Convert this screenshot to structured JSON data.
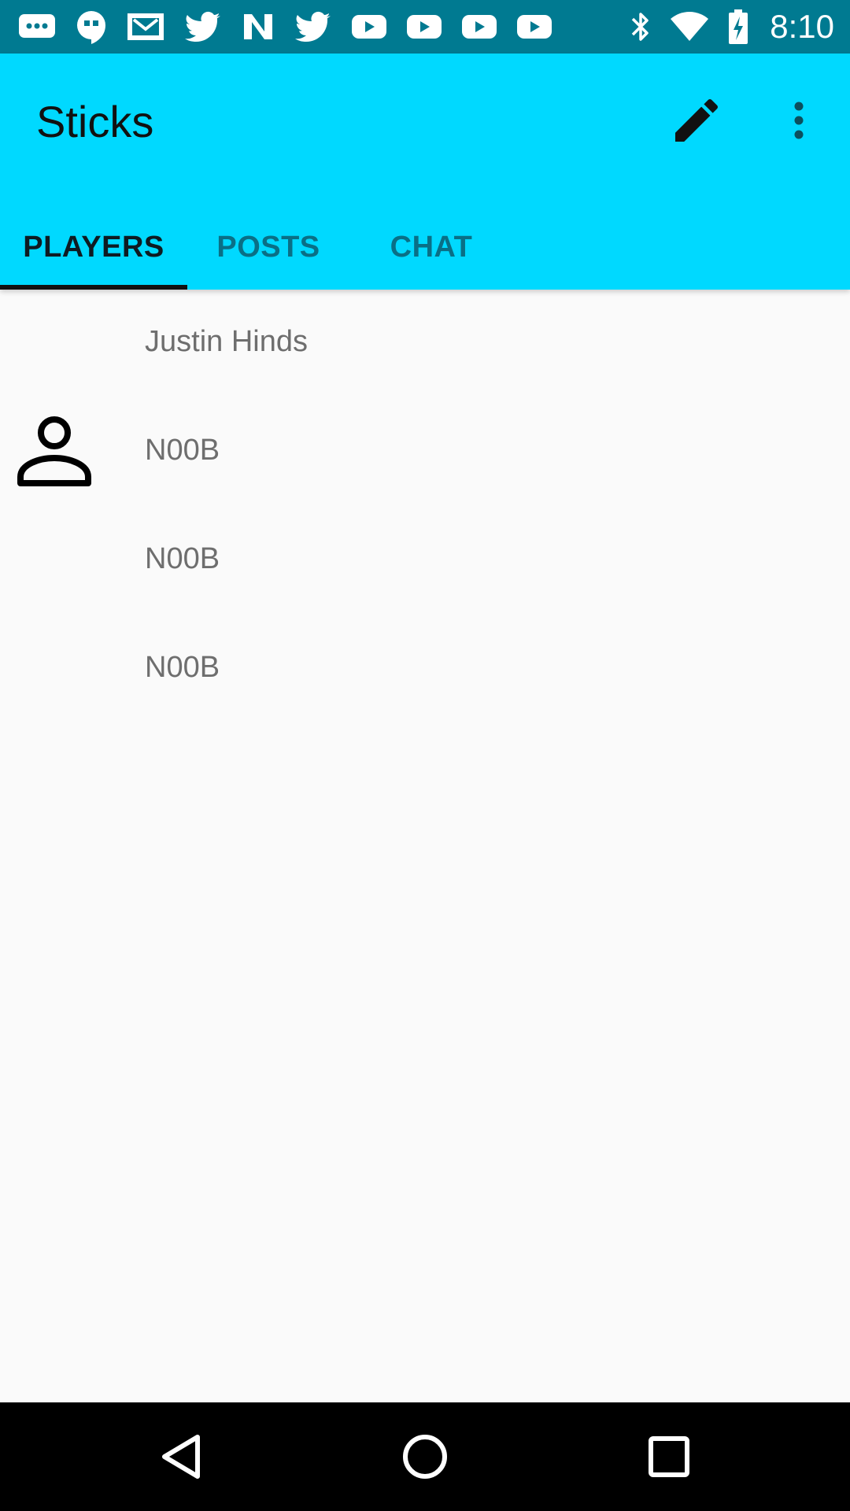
{
  "status_bar": {
    "time": "8:10",
    "notification_icons": [
      "message-icon",
      "hangouts-icon",
      "gmail-icon",
      "twitter-icon",
      "news-icon",
      "twitter-icon",
      "youtube-icon",
      "youtube-icon",
      "youtube-icon",
      "youtube-icon"
    ],
    "system_icons": [
      "bluetooth-icon",
      "wifi-icon",
      "battery-charging-icon"
    ],
    "color": "#007a91"
  },
  "app_bar": {
    "title": "Sticks",
    "color": "#00d9ff",
    "actions": [
      "edit-icon",
      "more-vert-icon"
    ]
  },
  "tabs": [
    {
      "label": "PLAYERS",
      "active": true
    },
    {
      "label": "POSTS",
      "active": false
    },
    {
      "label": "CHAT",
      "active": false
    }
  ],
  "players": [
    {
      "name": "Justin Hinds"
    },
    {
      "name": "N00B"
    },
    {
      "name": "N00B"
    },
    {
      "name": "N00B"
    }
  ],
  "nav_bar": {
    "buttons": [
      "back-icon",
      "home-icon",
      "recents-icon"
    ]
  }
}
